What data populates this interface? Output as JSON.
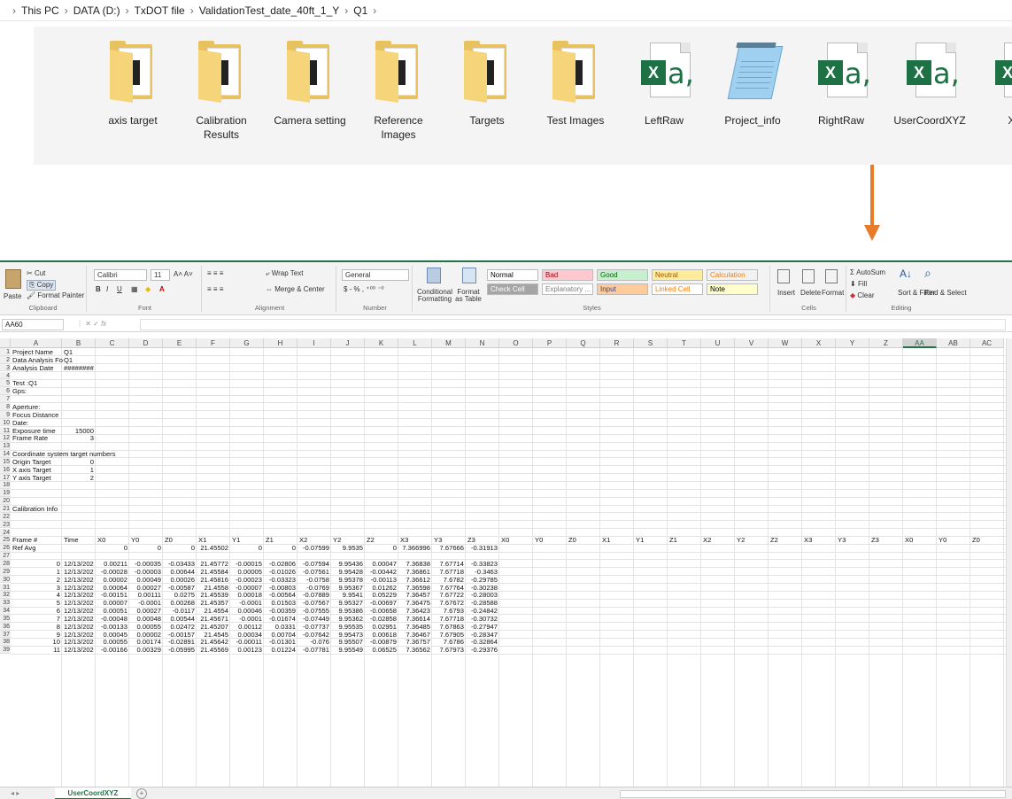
{
  "breadcrumb": [
    "This PC",
    "DATA (D:)",
    "TxDOT file",
    "ValidationTest_date_40ft_1_Y",
    "Q1"
  ],
  "files": [
    {
      "label": "axis target",
      "icon": "folder-icon",
      "kind": "folder"
    },
    {
      "label": "Calibration Results",
      "icon": "folder-icon",
      "kind": "folder"
    },
    {
      "label": "Camera setting",
      "icon": "folder-icon",
      "kind": "folder"
    },
    {
      "label": "Reference Images",
      "icon": "folder-icon",
      "kind": "folder"
    },
    {
      "label": "Targets",
      "icon": "folder-icon",
      "kind": "folder"
    },
    {
      "label": "Test Images",
      "icon": "folder-icon",
      "kind": "folder"
    },
    {
      "label": "LeftRaw",
      "icon": "excel-csv-icon",
      "kind": "excel"
    },
    {
      "label": "Project_info",
      "icon": "notepad-icon",
      "kind": "notepad"
    },
    {
      "label": "RightRaw",
      "icon": "excel-csv-icon",
      "kind": "excel"
    },
    {
      "label": "UserCoordXYZ",
      "icon": "excel-csv-icon",
      "kind": "excel"
    },
    {
      "label": "XYZ",
      "icon": "excel-csv-icon",
      "kind": "excel"
    }
  ],
  "colors": {
    "arrow": "#e87b2a",
    "excel_green": "#217346",
    "folder": "#e8c25f"
  },
  "ribbon": {
    "clipboard": {
      "cut": "Cut",
      "copy": "Copy",
      "paste": "Paste",
      "format_painter": "Format Painter",
      "label": "Clipboard"
    },
    "font": {
      "name": "Calibri",
      "size": "11",
      "label": "Font"
    },
    "alignment": {
      "wrap": "Wrap Text",
      "merge": "Merge & Center",
      "label": "Alignment"
    },
    "number": {
      "format": "General",
      "label": "Number"
    },
    "styles": {
      "conditional": "Conditional Formatting",
      "format_as": "Format as Table",
      "cells": [
        {
          "label": "Normal",
          "bg": "#ffffff",
          "fg": "#000000"
        },
        {
          "label": "Bad",
          "bg": "#ffc7ce",
          "fg": "#9c0006"
        },
        {
          "label": "Good",
          "bg": "#c6efce",
          "fg": "#006100"
        },
        {
          "label": "Neutral",
          "bg": "#ffeb9c",
          "fg": "#9c5700"
        },
        {
          "label": "Calculation",
          "bg": "#f2f2f2",
          "fg": "#fa7d00"
        },
        {
          "label": "Check Cell",
          "bg": "#a5a5a5",
          "fg": "#ffffff"
        },
        {
          "label": "Explanatory ...",
          "bg": "#ffffff",
          "fg": "#7f7f7f"
        },
        {
          "label": "Input",
          "bg": "#ffcc99",
          "fg": "#3f3f76"
        },
        {
          "label": "Linked Cell",
          "bg": "#ffffff",
          "fg": "#fa7d00"
        },
        {
          "label": "Note",
          "bg": "#ffffcc",
          "fg": "#000000"
        }
      ],
      "label": "Styles"
    },
    "cells": {
      "insert": "Insert",
      "delete": "Delete",
      "format": "Format",
      "label": "Cells"
    },
    "editing": {
      "autosum": "AutoSum",
      "fill": "Fill",
      "clear": "Clear",
      "sort": "Sort & Filter",
      "find": "Find & Select",
      "label": "Editing"
    }
  },
  "formula_bar": {
    "name_box": "AA60",
    "fx": "fx",
    "value": ""
  },
  "columns": [
    "A",
    "B",
    "C",
    "D",
    "E",
    "F",
    "G",
    "H",
    "I",
    "J",
    "K",
    "L",
    "M",
    "N",
    "O",
    "P",
    "Q",
    "R",
    "S",
    "T",
    "U",
    "V",
    "W",
    "X",
    "Y",
    "Z",
    "AA",
    "AB",
    "AC"
  ],
  "rows": [
    [
      "Project Name",
      "Q1"
    ],
    [
      "Data Analysis Fo",
      "Q1"
    ],
    [
      "Analysis Date",
      "########"
    ],
    [],
    [
      "Test :Q1"
    ],
    [
      "Gps:"
    ],
    [],
    [
      "Aperture:"
    ],
    [
      "Focus Distance"
    ],
    [
      "Date:"
    ],
    [
      "Exposure time",
      "15000"
    ],
    [
      "Frame Rate",
      "3"
    ],
    [],
    [
      "Coordinate system target numbers"
    ],
    [
      "Origin Target",
      "0"
    ],
    [
      "X axis Target",
      "1"
    ],
    [
      "Y axis Target",
      "2"
    ],
    [],
    [],
    [],
    [
      "Calibration Info"
    ],
    [],
    [],
    [],
    [
      "Frame #",
      "Time",
      "X0",
      "Y0",
      "Z0",
      "X1",
      "Y1",
      "Z1",
      "X2",
      "Y2",
      "Z2",
      "X3",
      "Y3",
      "Z3",
      "X0",
      "Y0",
      "Z0",
      "X1",
      "Y1",
      "Z1",
      "X2",
      "Y2",
      "Z2",
      "X3",
      "Y3",
      "Z3",
      "X0",
      "Y0",
      "Z0"
    ],
    [
      "Ref Avg",
      "",
      "0",
      "0",
      "0",
      "21.45502",
      "0",
      "0",
      "-0.07599",
      "9.9535",
      "0",
      "7.366996",
      "7.67666",
      "-0.31913"
    ],
    [],
    [
      "0",
      "12/13/202",
      "0.00211",
      "-0.00035",
      "-0.03433",
      "21.45772",
      "-0.00015",
      "-0.02806",
      "-0.07594",
      "9.95436",
      "0.00047",
      "7.36838",
      "7.67714",
      "-0.33823"
    ],
    [
      "1",
      "12/13/202",
      "-0.00028",
      "-0.00003",
      "0.00644",
      "21.45584",
      "0.00005",
      "-0.01026",
      "-0.07561",
      "9.95428",
      "-0.00442",
      "7.36861",
      "7.67718",
      "-0.3463"
    ],
    [
      "2",
      "12/13/202",
      "0.00002",
      "0.00049",
      "0.00026",
      "21.45816",
      "-0.00023",
      "-0.03323",
      "-0.0758",
      "9.95378",
      "-0.00113",
      "7.36612",
      "7.6782",
      "-0.29785"
    ],
    [
      "3",
      "12/13/202",
      "0.00064",
      "0.00027",
      "-0.00587",
      "21.4558",
      "-0.00007",
      "-0.00803",
      "-0.0769",
      "9.95367",
      "0.01262",
      "7.36598",
      "7.67764",
      "-0.30238"
    ],
    [
      "4",
      "12/13/202",
      "-0.00151",
      "0.00111",
      "0.0275",
      "21.45539",
      "0.00018",
      "-0.00564",
      "-0.07889",
      "9.9541",
      "0.05229",
      "7.36457",
      "7.67722",
      "-0.28003"
    ],
    [
      "5",
      "12/13/202",
      "0.00007",
      "-0.0001",
      "0.00268",
      "21.45357",
      "-0.0001",
      "0.01503",
      "-0.07567",
      "9.95327",
      "-0.00697",
      "7.36475",
      "7.67672",
      "-0.28588"
    ],
    [
      "6",
      "12/13/202",
      "0.00051",
      "0.00027",
      "-0.0117",
      "21.4554",
      "0.00046",
      "-0.00359",
      "-0.07555",
      "9.95386",
      "-0.00658",
      "7.36423",
      "7.6793",
      "-0.24842"
    ],
    [
      "7",
      "12/13/202",
      "-0.00048",
      "0.00048",
      "0.00544",
      "21.45671",
      "-0.0001",
      "-0.01674",
      "-0.07449",
      "9.95362",
      "-0.02858",
      "7.36614",
      "7.67718",
      "-0.30732"
    ],
    [
      "8",
      "12/13/202",
      "-0.00133",
      "0.00055",
      "0.02472",
      "21.45207",
      "0.00112",
      "0.0331",
      "-0.07737",
      "9.95535",
      "0.02951",
      "7.36485",
      "7.67863",
      "-0.27947"
    ],
    [
      "9",
      "12/13/202",
      "0.00045",
      "0.00002",
      "-0.00157",
      "21.4545",
      "0.00034",
      "0.00704",
      "-0.07642",
      "9.95473",
      "0.00618",
      "7.36467",
      "7.67905",
      "-0.28347"
    ],
    [
      "10",
      "12/13/202",
      "0.00055",
      "0.00174",
      "-0.02891",
      "21.45642",
      "-0.00011",
      "-0.01301",
      "-0.076",
      "9.95507",
      "-0.00879",
      "7.36757",
      "7.6786",
      "-0.32864"
    ],
    [
      "11",
      "12/13/202",
      "-0.00166",
      "0.00329",
      "-0.05995",
      "21.45569",
      "0.00123",
      "0.01224",
      "-0.07781",
      "9.95549",
      "0.06525",
      "7.36562",
      "7.67973",
      "-0.29376"
    ]
  ],
  "sheet_tab": "UserCoordXYZ"
}
